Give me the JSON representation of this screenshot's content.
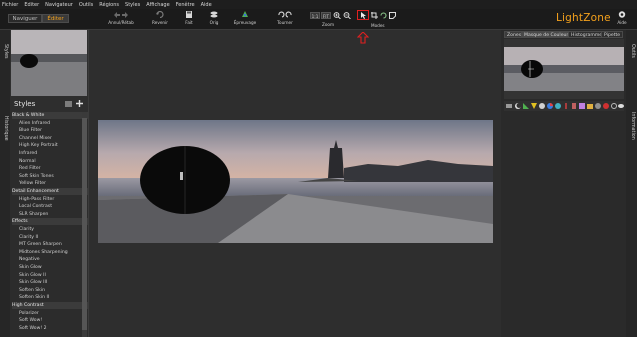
{
  "menu": [
    "Fichier",
    "Editer",
    "Navigateur",
    "Outils",
    "Régions",
    "Styles",
    "Affichage",
    "Fenêtre",
    "Aide"
  ],
  "modes": {
    "browse": "Naviguer",
    "edit": "Éditer"
  },
  "toolbar": {
    "undo_redo": "Annul/Rétab",
    "revert": "Revenir",
    "done": "Fait",
    "orig": "Orig",
    "eyedropper": "Épreuvage",
    "rotate": "Tourner",
    "zoom_level": "1:1",
    "zoom_fit": "FIT",
    "zoom": "Zoom",
    "mode": "Modes",
    "help": "Aide"
  },
  "logo": "LightZone",
  "left_strip": {
    "styles": "Styles",
    "history": "Historique"
  },
  "styles_panel": {
    "title": "Styles",
    "items": [
      {
        "label": "Black & White",
        "kind": "cat"
      },
      {
        "label": "Alien Infrared",
        "kind": "sub"
      },
      {
        "label": "Blue Filter",
        "kind": "sub"
      },
      {
        "label": "Channel Mixer",
        "kind": "sub"
      },
      {
        "label": "High Key Portrait",
        "kind": "sub"
      },
      {
        "label": "Infrared",
        "kind": "sub"
      },
      {
        "label": "Normal",
        "kind": "sub"
      },
      {
        "label": "Red Filter",
        "kind": "sub"
      },
      {
        "label": "Soft Skin Tones",
        "kind": "sub"
      },
      {
        "label": "Yellow Filter",
        "kind": "sub"
      },
      {
        "label": "Detail Enhancement",
        "kind": "cat"
      },
      {
        "label": "High-Pass Filter",
        "kind": "sub"
      },
      {
        "label": "Local Contrast",
        "kind": "sub"
      },
      {
        "label": "SLR Sharpen",
        "kind": "sub"
      },
      {
        "label": "Effects",
        "kind": "cat"
      },
      {
        "label": "Clarity",
        "kind": "sub"
      },
      {
        "label": "Clarity II",
        "kind": "sub"
      },
      {
        "label": "MT Green Sharpen",
        "kind": "sub"
      },
      {
        "label": "Midtones Sharpening",
        "kind": "sub"
      },
      {
        "label": "Negative",
        "kind": "sub"
      },
      {
        "label": "Skin Glow",
        "kind": "sub"
      },
      {
        "label": "Skin Glow II",
        "kind": "sub"
      },
      {
        "label": "Skin Glow III",
        "kind": "sub"
      },
      {
        "label": "Soften Skin",
        "kind": "sub"
      },
      {
        "label": "Soften Skin II",
        "kind": "sub"
      },
      {
        "label": "High Contrast",
        "kind": "cat"
      },
      {
        "label": "Polarizer",
        "kind": "sub"
      },
      {
        "label": "Soft Wow!",
        "kind": "sub"
      },
      {
        "label": "Soft Wow! 2",
        "kind": "sub"
      }
    ]
  },
  "right_panel": {
    "tabs": [
      "Zones",
      "Masque de Couleur",
      "Histogramme",
      "Pipette"
    ]
  },
  "right_strip": {
    "tools": "Outils",
    "info": "Information"
  },
  "colors": {
    "accent": "#f4a11c",
    "highlight": "#e02020",
    "menu_bg": "#1e1e1e",
    "panel_bg": "#2e2e2e",
    "canvas_bg": "#2b2b2b"
  }
}
